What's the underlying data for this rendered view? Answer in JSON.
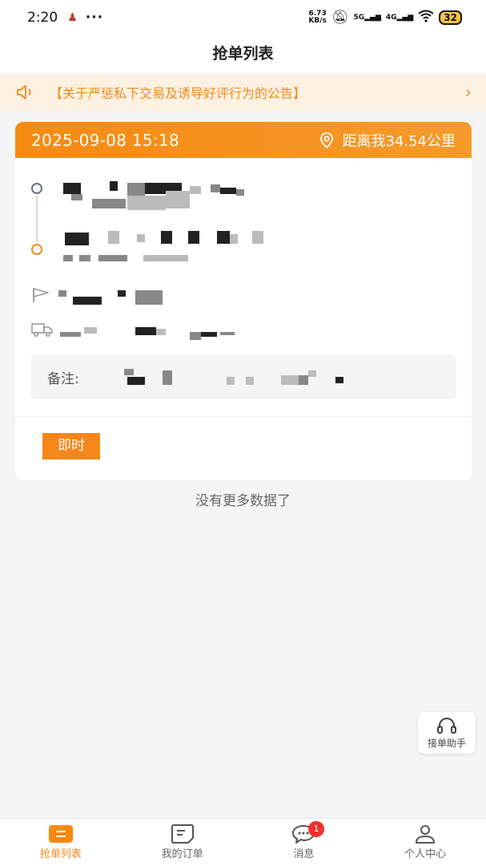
{
  "status_bar": {
    "time": "2:20",
    "more": "···",
    "net_speed_top": "6.73",
    "net_speed_bottom": "KB/s",
    "sim1": "5G",
    "sim2": "4G",
    "battery": "32"
  },
  "header": {
    "title": "抢单列表"
  },
  "notice": {
    "text": "【关于严惩私下交易及诱导好评行为的公告】"
  },
  "order_card": {
    "datetime": "2025-09-08 15:18",
    "distance": "距离我34.54公里",
    "remark_label": "备注:",
    "tag": "即时"
  },
  "list_footer": "没有更多数据了",
  "assistant": {
    "label": "接单助手"
  },
  "tabbar": {
    "items": [
      {
        "label": "抢单列表"
      },
      {
        "label": "我的订单"
      },
      {
        "label": "消息"
      },
      {
        "label": "个人中心"
      }
    ],
    "message_badge": "1"
  },
  "colors": {
    "accent": "#f58a12",
    "notice_bg": "#fdf1e2",
    "badge": "#f02f2f"
  },
  "icons": [
    "speaker-icon",
    "chevron-right-icon",
    "location-pin-icon",
    "flag-icon",
    "truck-icon",
    "headset-icon",
    "list-icon",
    "orders-icon",
    "chat-icon",
    "person-icon"
  ]
}
